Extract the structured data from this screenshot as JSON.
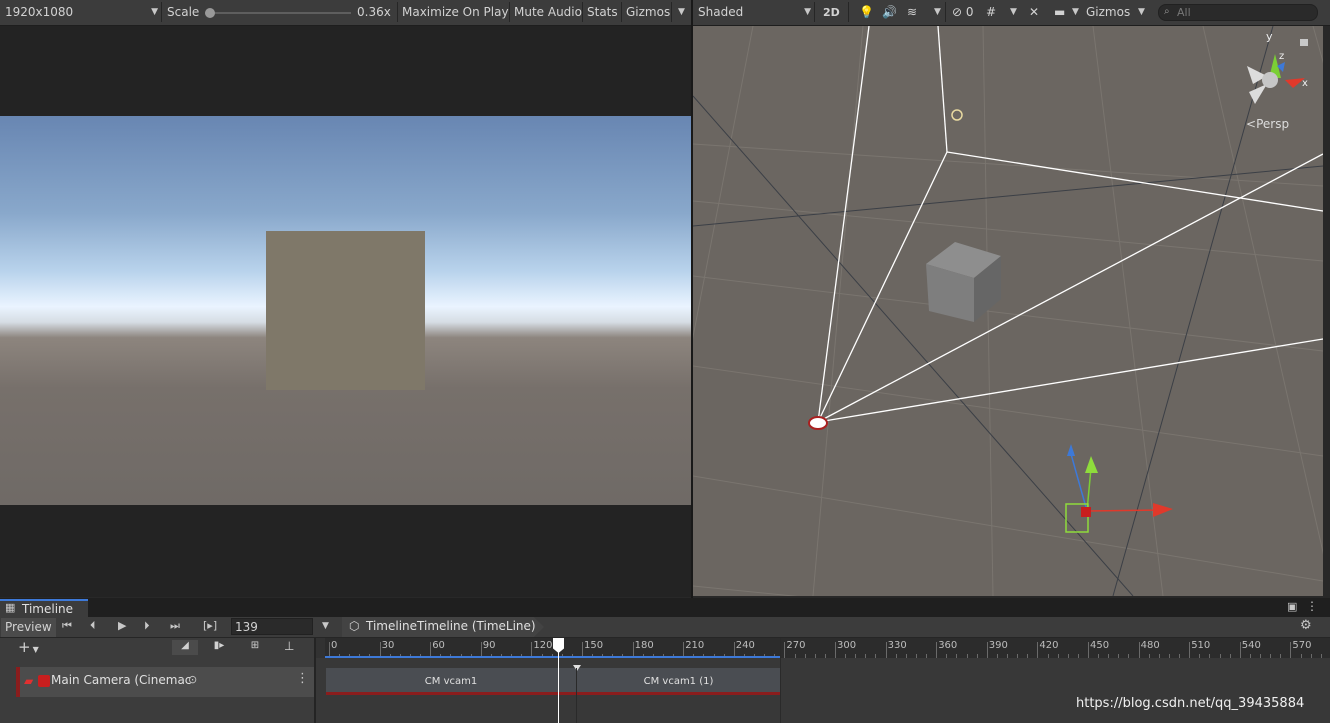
{
  "game_view": {
    "resolution": "1920x1080",
    "scale_label": "Scale",
    "scale_value": "0.36x",
    "maximize_on_play": "Maximize On Play",
    "mute_audio": "Mute Audio",
    "stats": "Stats",
    "gizmos": "Gizmos"
  },
  "scene_view": {
    "shading_mode": "Shaded",
    "mode_2d": "2D",
    "hidden_count": "0",
    "gizmos": "Gizmos",
    "search_placeholder": "All",
    "axis_y": "y",
    "axis_z": "z",
    "axis_x": "x",
    "projection": "Persp"
  },
  "timeline": {
    "tab_label": "Timeline",
    "preview_label": "Preview",
    "frame_bracket": "[▸]",
    "current_frame": "139",
    "asset_name": "TimelineTimeline (TimeLine)",
    "ruler_labels": [
      "0",
      "30",
      "60",
      "90",
      "120",
      "150",
      "180",
      "210",
      "240",
      "270",
      "300",
      "330",
      "360",
      "390",
      "420",
      "450",
      "480",
      "510",
      "540",
      "570"
    ],
    "track_name": "Main Camera (Cinemac",
    "clips": [
      {
        "label": "CM vcam1"
      },
      {
        "label": "CM vcam1 (1)"
      }
    ]
  },
  "watermark": "https://blog.csdn.net/qq_39435884",
  "colors": {
    "panel_bg": "#3c3c3c",
    "sky_top": "#6a88b3",
    "horizon": "#e8f2ff",
    "ground": "#77706b",
    "scene_bg": "#6b6661",
    "accent_blue": "#3d79d8",
    "track_red": "#8a1d1d",
    "playhead": "#ffffff"
  }
}
